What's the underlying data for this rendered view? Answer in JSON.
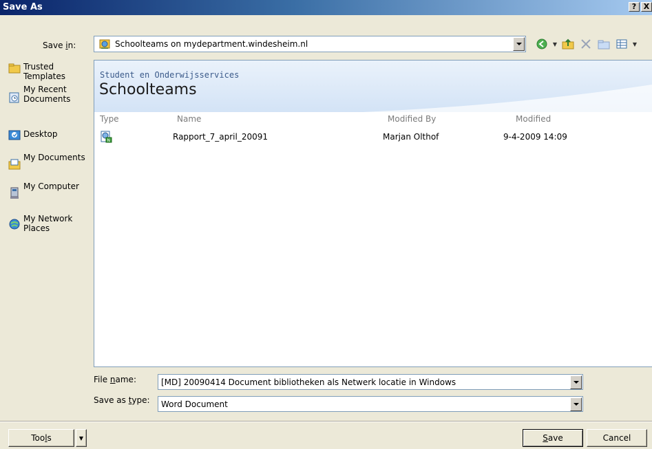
{
  "window": {
    "title": "Save As",
    "help_glyph": "?",
    "close_glyph": "X"
  },
  "save_in": {
    "label": "Save in:",
    "value": "Schoolteams on mydepartment.windesheim.nl"
  },
  "toolbar": {
    "icons": [
      "back-icon",
      "up-folder-icon",
      "delete-icon",
      "new-folder-icon",
      "views-icon"
    ]
  },
  "places": [
    {
      "label": "Trusted Templates",
      "icon": "folder-icon"
    },
    {
      "label": "My Recent Documents",
      "icon": "recent-documents-icon"
    },
    {
      "label": "Desktop",
      "icon": "desktop-icon"
    },
    {
      "label": "My Documents",
      "icon": "my-documents-icon"
    },
    {
      "label": "My Computer",
      "icon": "my-computer-icon"
    },
    {
      "label": "My Network Places",
      "icon": "network-places-icon"
    }
  ],
  "site": {
    "subtitle": "Student en Onderwijsservices",
    "title": "Schoolteams"
  },
  "columns": {
    "type": "Type",
    "name": "Name",
    "modified_by": "Modified By",
    "modified": "Modified"
  },
  "files": [
    {
      "icon": "word-document-icon",
      "name": "Rapport_7_april_20091",
      "modified_by": "Marjan Olthof",
      "modified": "9-4-2009 14:09"
    }
  ],
  "file_name": {
    "label": "File name:",
    "value": "[MD] 20090414 Document bibliotheken als Netwerk locatie in Windows"
  },
  "save_as_type": {
    "label": "Save as type:",
    "value": "Word Document"
  },
  "buttons": {
    "tools": "Tools",
    "save": "Save",
    "cancel": "Cancel"
  }
}
